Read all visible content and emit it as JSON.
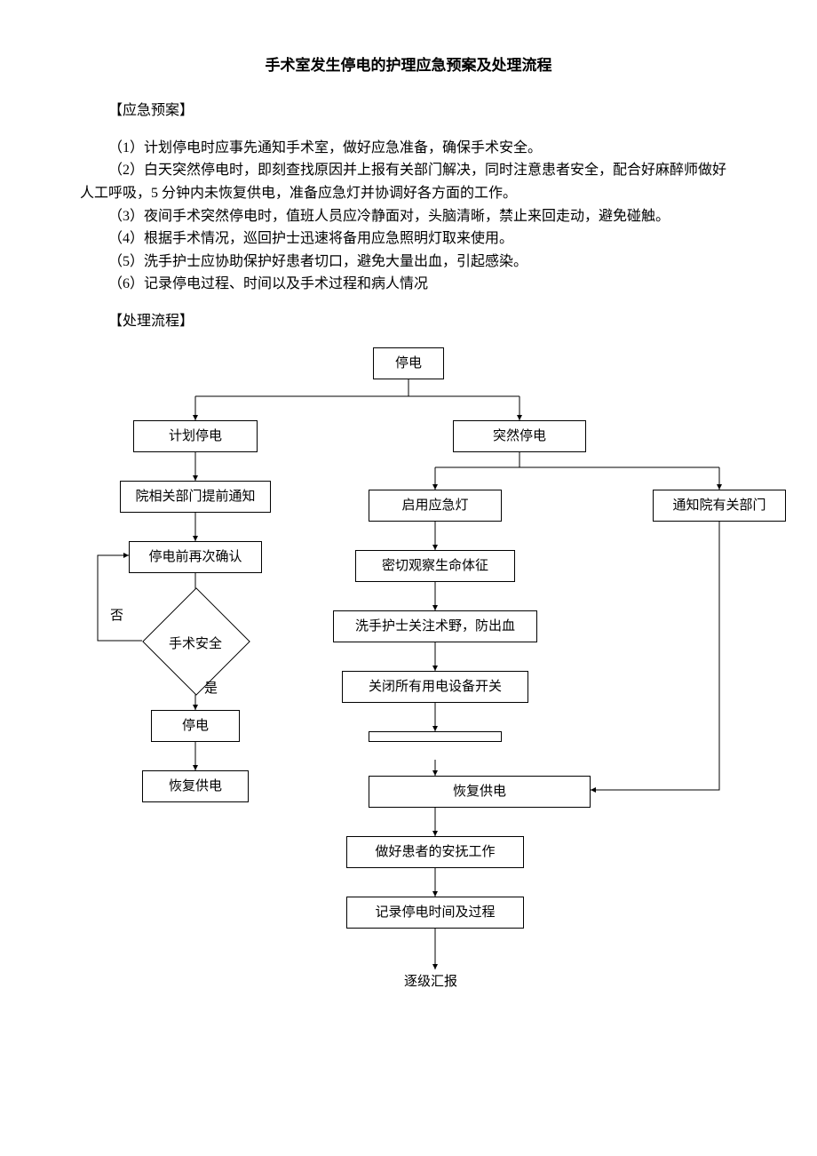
{
  "title": "手术室发生停电的护理应急预案及处理流程",
  "section_plan": "【应急预案】",
  "items": [
    "（1）计划停电时应事先通知手术室，做好应急准备，确保手术安全。",
    "（2）白天突然停电时，即刻查找原因并上报有关部门解决，同时注意患者安全，配合好麻醉师做好人工呼吸，5 分钟内未恢复供电，准备应急灯并协调好各方面的工作。",
    "（3）夜间手术突然停电时，值班人员应冷静面对，头脑清晰，禁止来回走动，避免碰触。",
    "（4）根据手术情况，巡回护士迅速将备用应急照明灯取来使用。",
    "（5）洗手护士应协助保护好患者切口，避免大量出血，引起感染。",
    "（6）记录停电过程、时间以及手术过程和病人情况"
  ],
  "section_flow": "【处理流程】",
  "flow": {
    "top": "停电",
    "left": {
      "b1": "计划停电",
      "b2": "院相关部门提前通知",
      "b3": "停电前再次确认",
      "d": "手术安全",
      "no": "否",
      "yes": "是",
      "b4": "停电",
      "b5": "恢复供电"
    },
    "right": {
      "b1": "突然停电",
      "b2": "启用应急灯",
      "b2b": "通知院有关部门",
      "b3": "密切观察生命体征",
      "b4": "洗手护士关注术野，防出血",
      "b5": "关闭所有用电设备开关",
      "b6": "恢复供电",
      "b7": "做好患者的安抚工作",
      "b8": "记录停电时间及过程",
      "end": "逐级汇报"
    }
  }
}
